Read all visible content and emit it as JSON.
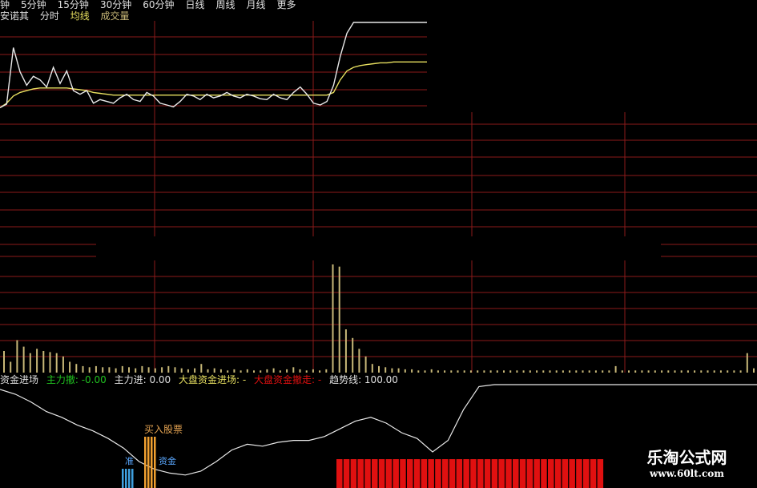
{
  "tabs": [
    "钟",
    "5分钟",
    "15分钟",
    "30分钟",
    "60分钟",
    "日线",
    "周线",
    "月线",
    "更多"
  ],
  "subbar": {
    "name": "安诺其",
    "fenshi": "分时",
    "avg": "均线",
    "volume": "成交量"
  },
  "indicator": {
    "name": "资金进场",
    "main_withdraw": "主力撤: -0.00",
    "main_in": "主力进: 0.00",
    "market_in": "大盘资金进场: -",
    "market_out": "大盘资金撤走: -",
    "trend": "趋势线: 100.00"
  },
  "buy_label": "买入股票",
  "zhun_label": "准",
  "fund_label": "资金",
  "watermark": {
    "cn": "乐淘公式网",
    "url": "www.60lt.com"
  },
  "colors": {
    "grid": "#8b1a1a",
    "price": "#e8e8e8",
    "avg": "#e8e060",
    "volume": "#c8b878",
    "red": "#e01010",
    "green": "#20c020",
    "blue": "#3fa0e0",
    "orange": "#f0a030"
  },
  "chart_data": {
    "type": "line",
    "price_series": [
      0.05,
      0.09,
      0.72,
      0.45,
      0.3,
      0.4,
      0.36,
      0.28,
      0.5,
      0.32,
      0.46,
      0.24,
      0.2,
      0.24,
      0.1,
      0.14,
      0.12,
      0.1,
      0.16,
      0.2,
      0.14,
      0.12,
      0.22,
      0.18,
      0.1,
      0.08,
      0.06,
      0.12,
      0.2,
      0.18,
      0.14,
      0.2,
      0.16,
      0.18,
      0.22,
      0.18,
      0.16,
      0.2,
      0.18,
      0.15,
      0.14,
      0.2,
      0.16,
      0.14,
      0.22,
      0.28,
      0.2,
      0.1,
      0.08,
      0.12,
      0.3,
      0.62,
      0.88,
      1.0,
      1.0,
      1.0,
      1.0,
      1.0,
      1.0,
      1.0,
      1.0,
      1.0,
      1.0,
      1.0,
      1.0
    ],
    "avg_series": [
      0.05,
      0.1,
      0.18,
      0.22,
      0.24,
      0.26,
      0.27,
      0.27,
      0.27,
      0.27,
      0.27,
      0.26,
      0.25,
      0.24,
      0.22,
      0.21,
      0.2,
      0.19,
      0.19,
      0.19,
      0.19,
      0.19,
      0.19,
      0.19,
      0.19,
      0.19,
      0.19,
      0.19,
      0.19,
      0.19,
      0.19,
      0.19,
      0.19,
      0.19,
      0.19,
      0.19,
      0.19,
      0.19,
      0.19,
      0.19,
      0.19,
      0.19,
      0.19,
      0.19,
      0.19,
      0.19,
      0.19,
      0.19,
      0.19,
      0.19,
      0.22,
      0.36,
      0.46,
      0.5,
      0.52,
      0.53,
      0.54,
      0.55,
      0.55,
      0.56,
      0.56,
      0.56,
      0.56,
      0.56,
      0.56
    ],
    "volume": [
      0.2,
      0.1,
      0.3,
      0.24,
      0.18,
      0.22,
      0.2,
      0.19,
      0.18,
      0.15,
      0.1,
      0.08,
      0.06,
      0.05,
      0.06,
      0.05,
      0.05,
      0.04,
      0.06,
      0.05,
      0.04,
      0.06,
      0.05,
      0.04,
      0.05,
      0.06,
      0.05,
      0.04,
      0.03,
      0.04,
      0.08,
      0.03,
      0.04,
      0.03,
      0.02,
      0.03,
      0.02,
      0.03,
      0.02,
      0.02,
      0.03,
      0.04,
      0.02,
      0.03,
      0.05,
      0.03,
      0.02,
      0.03,
      0.02,
      0.03,
      1.0,
      0.98,
      0.4,
      0.32,
      0.22,
      0.15,
      0.08,
      0.06,
      0.05,
      0.04,
      0.04,
      0.03,
      0.03,
      0.02,
      0.02,
      0.03,
      0.02,
      0.02,
      0.02,
      0.02,
      0.02,
      0.02,
      0.02,
      0.02,
      0.02,
      0.02,
      0.02,
      0.02,
      0.02,
      0.02,
      0.02,
      0.02,
      0.02,
      0.02,
      0.02,
      0.02,
      0.02,
      0.02,
      0.02,
      0.02,
      0.02,
      0.02,
      0.02,
      0.06,
      0.02,
      0.02,
      0.02,
      0.02,
      0.02,
      0.02,
      0.02,
      0.02,
      0.02,
      0.02,
      0.02,
      0.02,
      0.02,
      0.02,
      0.02,
      0.02,
      0.02,
      0.02,
      0.02,
      0.18,
      0.04
    ],
    "trend": [
      0.95,
      0.9,
      0.82,
      0.72,
      0.66,
      0.58,
      0.52,
      0.44,
      0.34,
      0.2,
      0.12,
      0.08,
      0.06,
      0.1,
      0.2,
      0.32,
      0.38,
      0.36,
      0.4,
      0.42,
      0.42,
      0.46,
      0.54,
      0.62,
      0.66,
      0.6,
      0.5,
      0.44,
      0.3,
      0.42,
      0.74,
      0.98,
      1.0,
      1.0,
      1.0,
      1.0,
      1.0,
      1.0,
      1.0,
      1.0,
      1.0,
      1.0,
      1.0,
      1.0,
      1.0,
      1.0,
      1.0,
      1.0,
      1.0,
      1.0
    ],
    "blue_bars": 4,
    "orange_bars": 4,
    "red_bars": 38
  }
}
